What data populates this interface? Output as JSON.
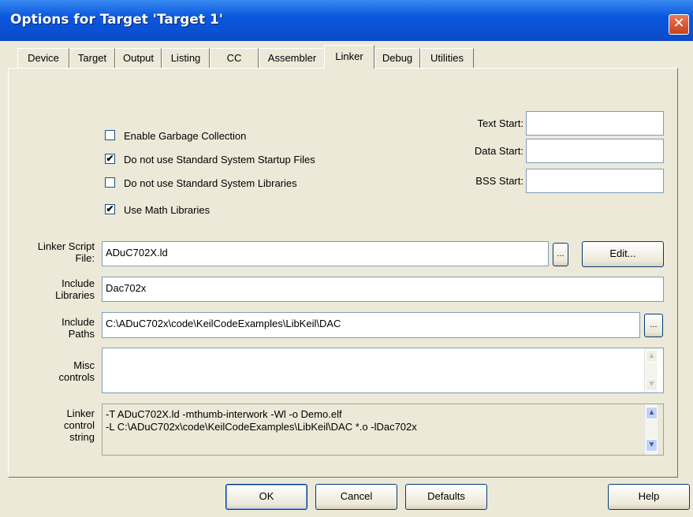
{
  "window": {
    "title": "Options for Target 'Target 1'",
    "close_glyph": "✕"
  },
  "tabs": [
    "Device",
    "Target",
    "Output",
    "Listing",
    "CC",
    "Assembler",
    "Linker",
    "Debug",
    "Utilities"
  ],
  "checkboxes": [
    {
      "label": "Enable Garbage Collection",
      "checked": false
    },
    {
      "label": "Do not use Standard System Startup Files",
      "checked": true
    },
    {
      "label": "Do not use Standard System Libraries",
      "checked": false
    },
    {
      "label": "Use Math Libraries",
      "checked": true
    }
  ],
  "check_glyph": "✔",
  "addresses": {
    "text_start_label": "Text Start:",
    "text_start": "",
    "data_start_label": "Data Start:",
    "data_start": "",
    "bss_start_label": "BSS Start:",
    "bss_start": ""
  },
  "script_file": {
    "label_line1": "Linker Script",
    "label_line2": "File:",
    "value": "ADuC702X.ld",
    "browse": "...",
    "edit": "Edit..."
  },
  "libraries": {
    "label_line1": "Include",
    "label_line2": "Libraries",
    "value": "Dac702x"
  },
  "paths": {
    "label_line1": "Include",
    "label_line2": "Paths",
    "value": "C:\\ADuC702x\\code\\KeilCodeExamples\\LibKeil\\DAC",
    "browse": "..."
  },
  "misc": {
    "label_line1": "Misc",
    "label_line2": "controls",
    "value": ""
  },
  "control_string": {
    "label_line1": "Linker",
    "label_line2": "control",
    "label_line3": "string",
    "line1": "-T ADuC702X.ld -mthumb-interwork -Wl -o Demo.elf",
    "line2": "-L C:\\ADuC702x\\code\\KeilCodeExamples\\LibKeil\\DAC *.o -lDac702x"
  },
  "scroll": {
    "up": "▲",
    "down": "▼"
  },
  "buttons": {
    "ok": "OK",
    "cancel": "Cancel",
    "defaults": "Defaults",
    "help": "Help"
  }
}
